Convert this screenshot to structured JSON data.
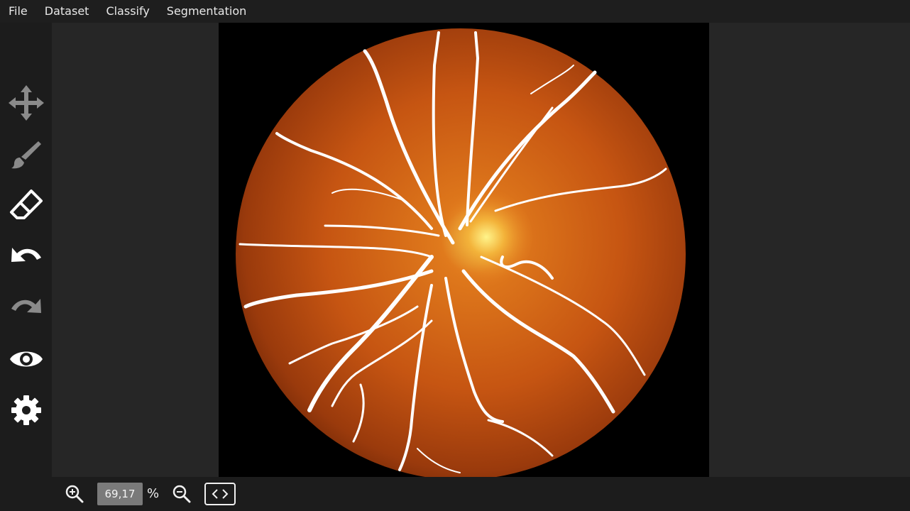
{
  "menu": {
    "file": "File",
    "dataset": "Dataset",
    "classify": "Classify",
    "segmentation": "Segmentation"
  },
  "toolbar": {
    "tools": [
      {
        "icon": "move-icon",
        "enabled": false
      },
      {
        "icon": "brush-icon",
        "enabled": false
      },
      {
        "icon": "eraser-icon",
        "enabled": true
      },
      {
        "icon": "undo-icon",
        "enabled": true
      },
      {
        "icon": "redo-icon",
        "enabled": false
      },
      {
        "icon": "eye-icon",
        "enabled": true
      },
      {
        "icon": "gear-icon",
        "enabled": true
      }
    ]
  },
  "zoom": {
    "value": "69,17",
    "unit": "%"
  },
  "colors": {
    "menubar_bg": "#1e1e1e",
    "viewport_bg": "#262626",
    "icon_active": "#ffffff",
    "icon_disabled": "#8a8a8a",
    "zoom_field_bg": "#7a7a7a"
  }
}
